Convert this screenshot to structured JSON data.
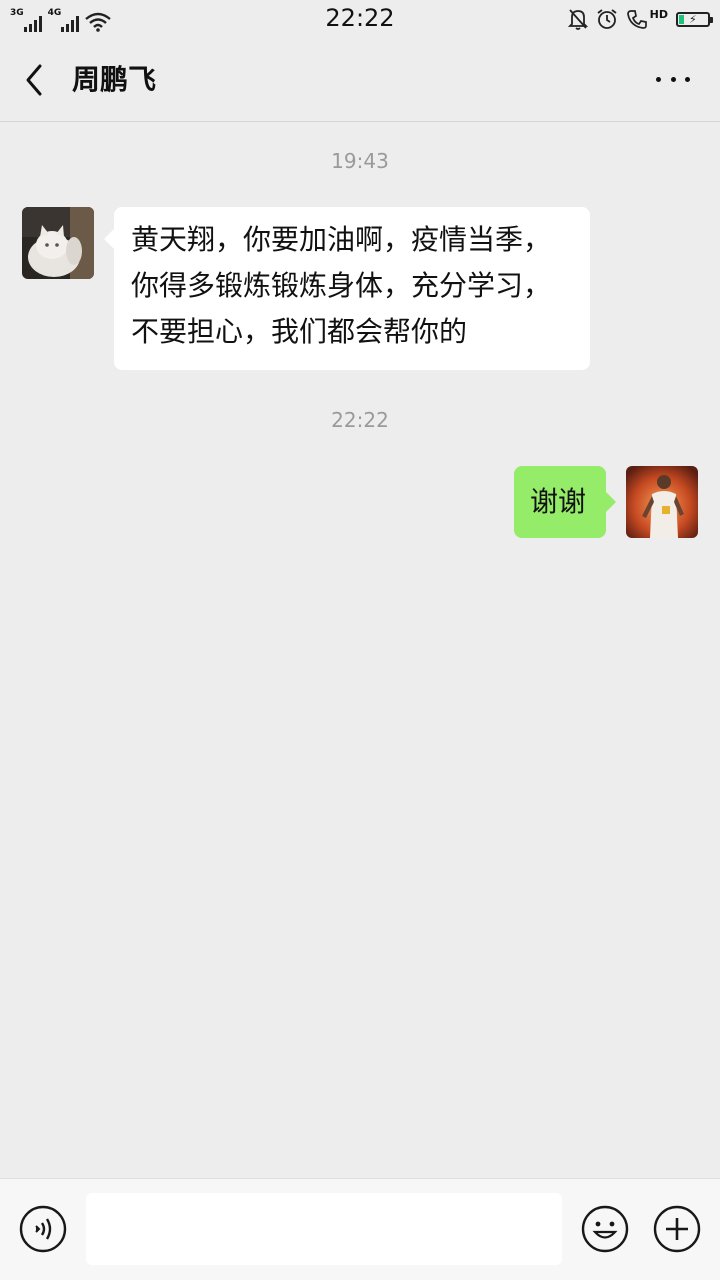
{
  "status_bar": {
    "sim1_label": "3G",
    "sim2_label": "4G",
    "time": "22:22",
    "hd_label": "HD",
    "icons": [
      "signal-icon",
      "signal-icon",
      "wifi-icon",
      "mute-icon",
      "alarm-icon",
      "hd-call-icon",
      "battery-charging-icon"
    ]
  },
  "header": {
    "title": "周鹏飞",
    "back_icon": "chevron-left-icon",
    "more_icon": "more-dots-icon"
  },
  "chat": {
    "messages": [
      {
        "timestamp": "19:43",
        "side": "left",
        "lines": [
          "黄天翔，你要加油啊，疫情当季，",
          "你得多锻炼锻炼身体，充分学习，",
          "不要担心，我们都会帮你的"
        ]
      },
      {
        "timestamp": "22:22",
        "side": "right",
        "text": "谢谢"
      }
    ]
  },
  "input_bar": {
    "voice_icon": "voice-icon",
    "text_value": "",
    "emoji_icon": "emoji-icon",
    "plus_icon": "plus-circle-icon"
  },
  "colors": {
    "background": "#ededed",
    "bubble_self": "#95ec69",
    "bubble_other": "#ffffff",
    "timestamp": "#9a9a9a"
  }
}
